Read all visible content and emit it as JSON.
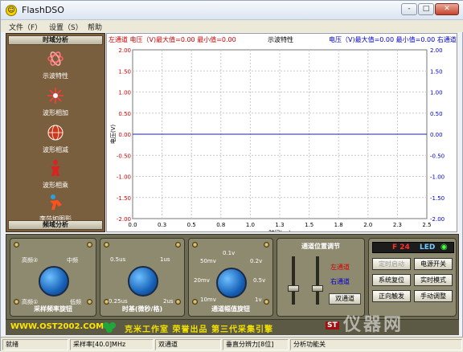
{
  "window": {
    "title": "FlashDSO",
    "app_icon": "☺",
    "minimize": "-",
    "maximize": "□",
    "close": "✕"
  },
  "menu": {
    "items": [
      "文件（F）",
      "设置（S）",
      "帮助"
    ]
  },
  "left_panel": {
    "header_top": "时域分析",
    "header_bottom": "频域分析",
    "items": [
      {
        "label": "示波特性",
        "icon": "wave-atom-icon"
      },
      {
        "label": "波形相加",
        "icon": "starburst-icon"
      },
      {
        "label": "波形相减",
        "icon": "globe-icon"
      },
      {
        "label": "波形相乘",
        "icon": "person-icon"
      },
      {
        "label": "李莎如图形",
        "icon": "figure-icon"
      }
    ]
  },
  "scope": {
    "left_header": "左通道 电压（V)最大值=0.00 最小值=0.00",
    "center_header": "示波特性",
    "right_header": "电压（V)最大值=0.00 最小值=0.00 右通道",
    "ylabel": "电压(V)",
    "xlabel": "时间(us)",
    "left_ticks": [
      "2.00",
      "1.50",
      "1.00",
      "0.50",
      "0.00",
      "-0.50",
      "-1.00",
      "-1.50",
      "-2.00"
    ],
    "right_ticks": [
      "2.00",
      "1.50",
      "1.00",
      "0.50",
      "0.00",
      "-0.50",
      "-1.00",
      "-1.50",
      "-2.00"
    ],
    "x_ticks": [
      "0.0",
      "0.3",
      "0.5",
      "0.8",
      "1.0",
      "1.3",
      "1.5",
      "1.8",
      "2.0",
      "2.3",
      "2.5"
    ],
    "colors": {
      "left": "#d00000",
      "right": "#0000cc",
      "trace": "#2020a0",
      "grid": "#c8c8c8"
    }
  },
  "chart_data": {
    "type": "line",
    "title": "示波特性",
    "xlabel": "时间(us)",
    "ylabel": "电压(V)",
    "xlim": [
      0.0,
      2.5
    ],
    "ylim": [
      -2.0,
      2.0
    ],
    "grid": true,
    "series": [
      {
        "x": [
          0.0,
          2.5
        ],
        "values": [
          0.0,
          0.0
        ]
      }
    ]
  },
  "controls": {
    "knob1": {
      "caption": "采样频率旋钮",
      "ticks": [
        "高频②",
        "中频",
        "高频①",
        "低频"
      ]
    },
    "knob2": {
      "caption": "时基(微秒/格)",
      "ticks": [
        "0.5us",
        "1us",
        "0.25us",
        "2us"
      ]
    },
    "knob3": {
      "caption": "通道幅值旋钮",
      "ticks": [
        "0.1v",
        "50mv",
        "0.2v",
        "20mv",
        "0.5v",
        "10mv",
        "1v"
      ]
    },
    "slider_panel": {
      "title": "通道位置调节",
      "left_channel": "左通道",
      "right_channel": "右通道",
      "dual_button": "双通道"
    },
    "led": {
      "label": "F 24",
      "led_text": "LED",
      "indicator": "◉"
    },
    "buttons": [
      {
        "label": "定时启动",
        "enabled": false
      },
      {
        "label": "电源开关",
        "enabled": true
      },
      {
        "label": "系统复位",
        "enabled": true
      },
      {
        "label": "实时模式",
        "enabled": true
      },
      {
        "label": "正向触发",
        "enabled": true
      },
      {
        "label": "手动调整",
        "enabled": true
      }
    ],
    "indicator_text": "ST"
  },
  "brand": {
    "url": "WWW.OST2002.COM",
    "slogan": "克米工作室 荣誉出品 第三代采集引擎",
    "watermark": "仪器网"
  },
  "status_bar": {
    "cells": [
      "就绪",
      "采样率[40.0]MHz",
      "双通道",
      "垂直分辨力[8位]",
      "分析功能关"
    ]
  }
}
